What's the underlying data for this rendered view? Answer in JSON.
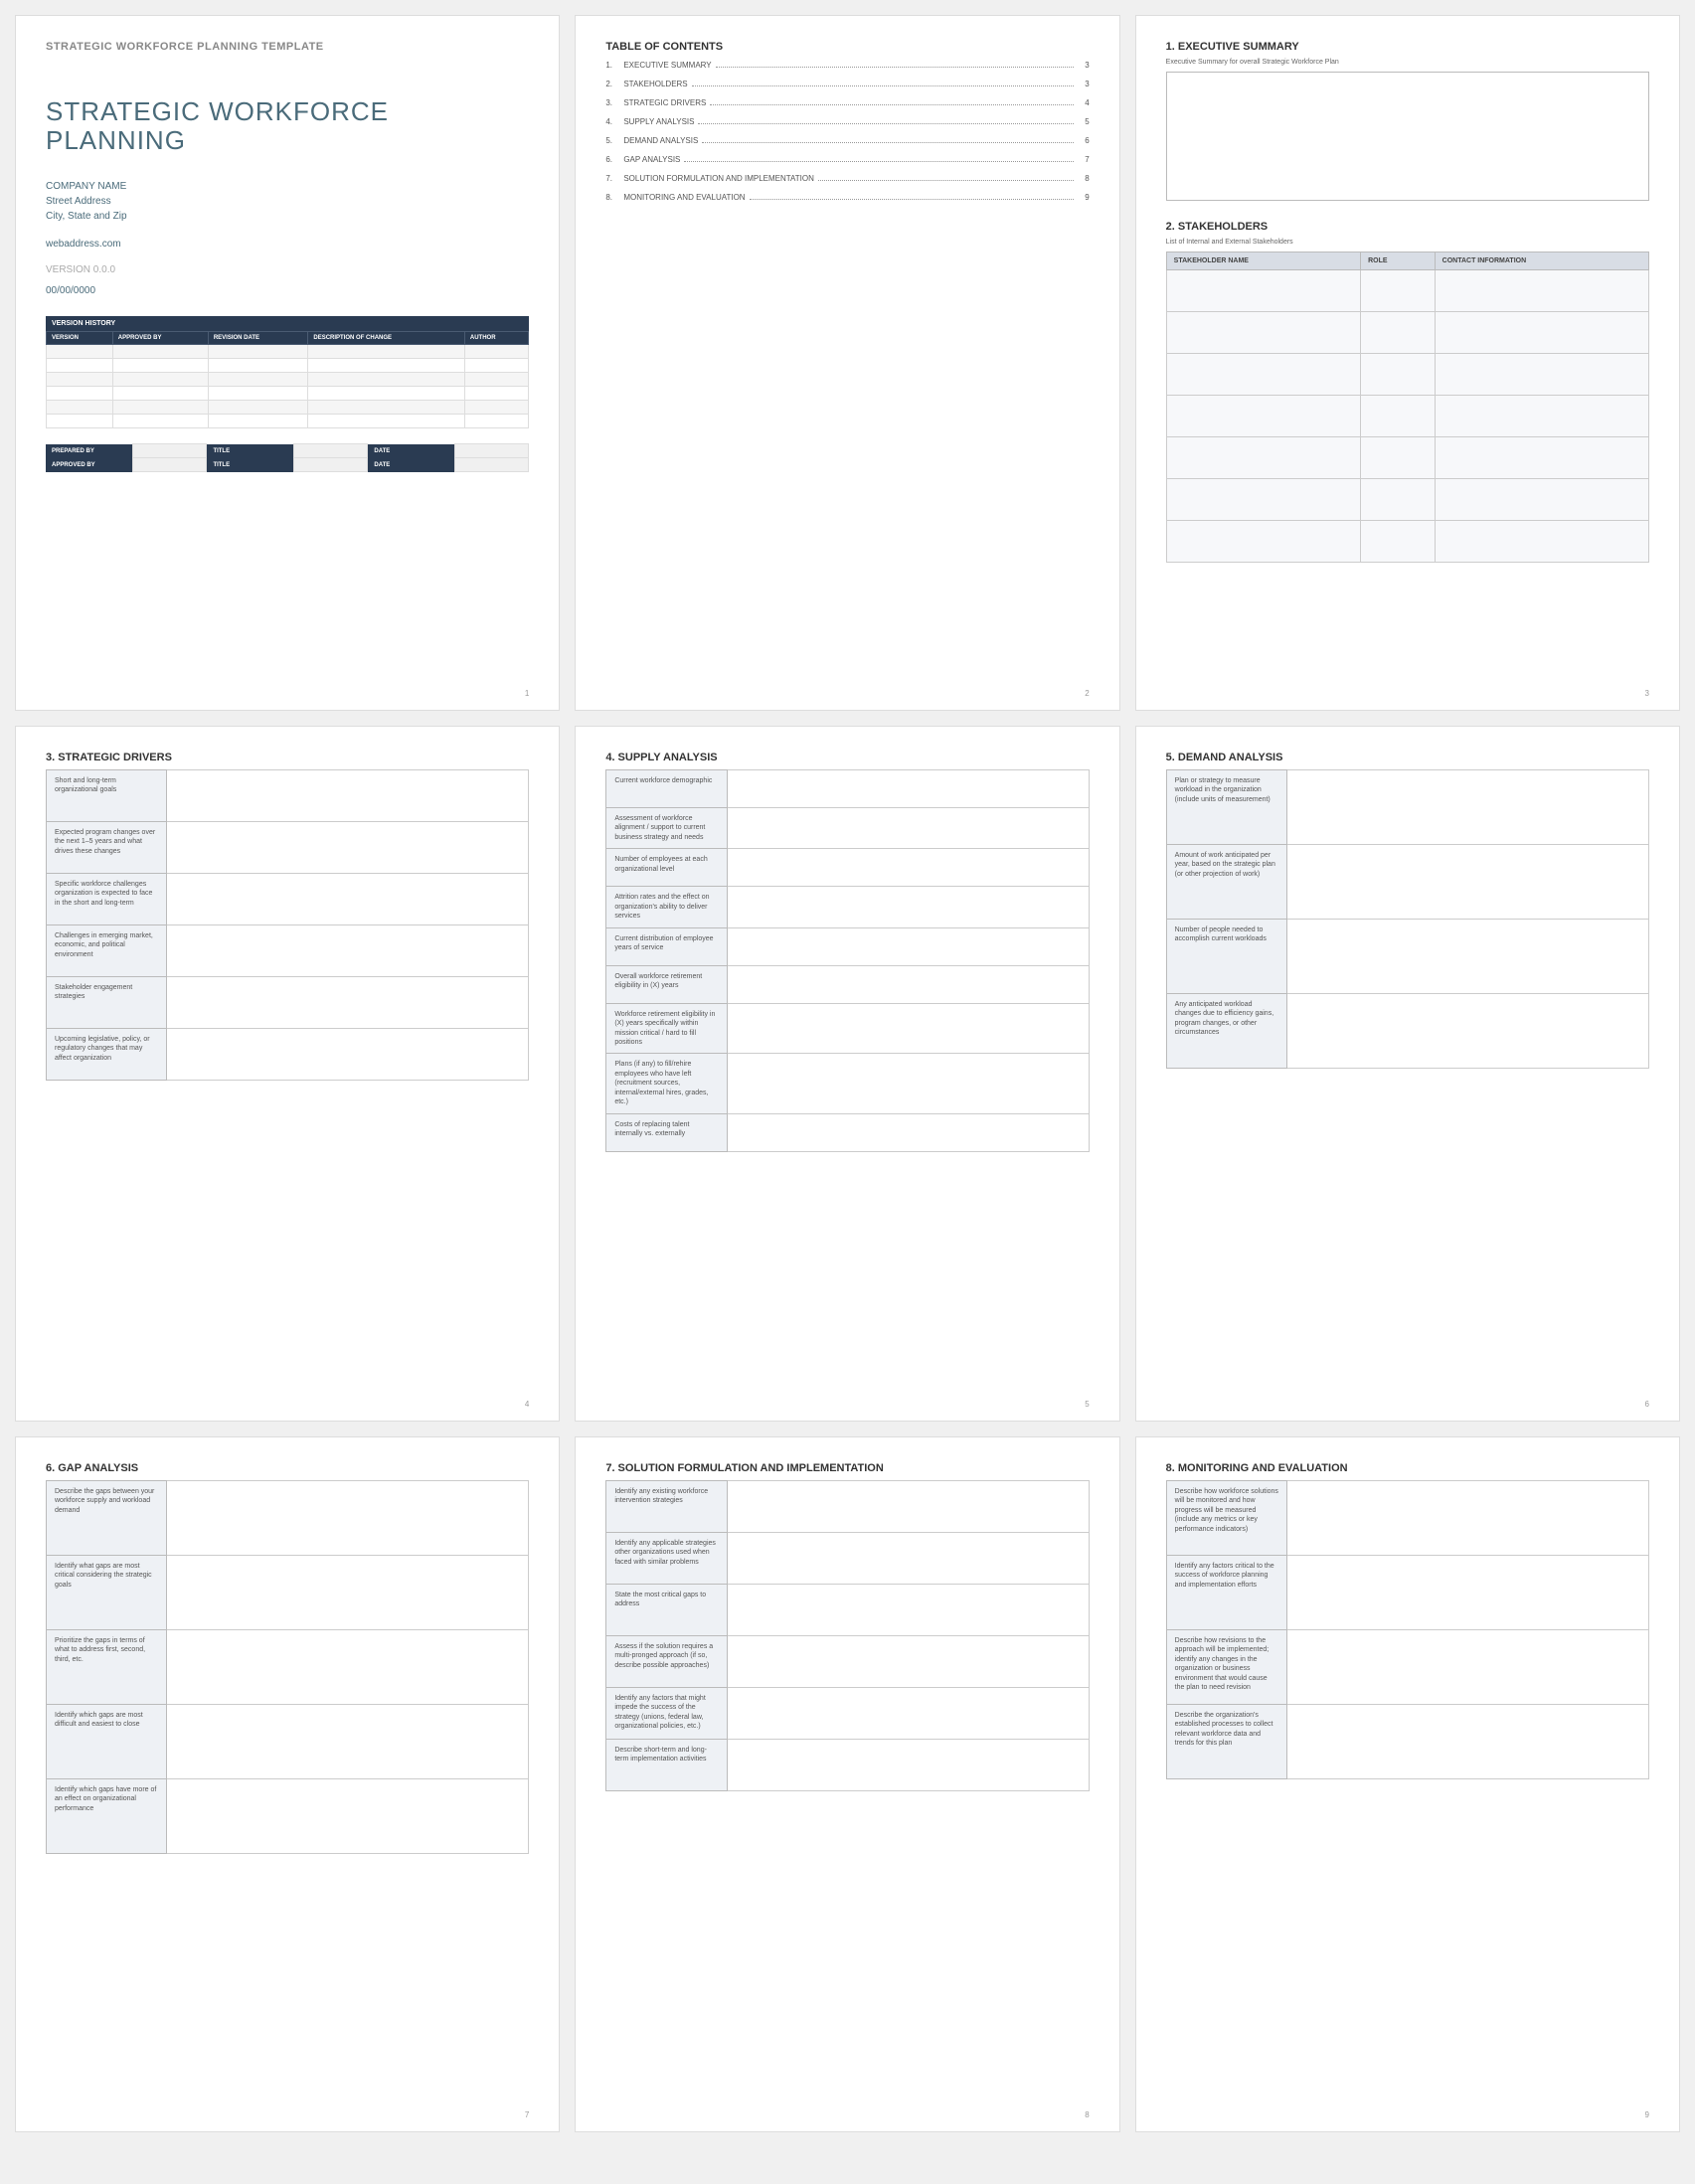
{
  "page1": {
    "template_header": "STRATEGIC WORKFORCE PLANNING TEMPLATE",
    "title": "STRATEGIC WORKFORCE PLANNING",
    "company": "COMPANY NAME",
    "street": "Street Address",
    "city": "City, State and Zip",
    "web": "webaddress.com",
    "version": "VERSION 0.0.0",
    "date": "00/00/0000",
    "vh_title": "VERSION HISTORY",
    "vh_headers": [
      "VERSION",
      "APPROVED BY",
      "REVISION DATE",
      "DESCRIPTION OF CHANGE",
      "AUTHOR"
    ],
    "sig": {
      "prepared": "PREPARED BY",
      "approved": "APPROVED BY",
      "title": "TITLE",
      "date": "DATE"
    }
  },
  "toc": {
    "heading": "TABLE OF CONTENTS",
    "items": [
      {
        "n": "1.",
        "label": "EXECUTIVE SUMMARY",
        "p": "3"
      },
      {
        "n": "2.",
        "label": "STAKEHOLDERS",
        "p": "3"
      },
      {
        "n": "3.",
        "label": "STRATEGIC DRIVERS",
        "p": "4"
      },
      {
        "n": "4.",
        "label": "SUPPLY ANALYSIS",
        "p": "5"
      },
      {
        "n": "5.",
        "label": "DEMAND ANALYSIS",
        "p": "6"
      },
      {
        "n": "6.",
        "label": "GAP ANALYSIS",
        "p": "7"
      },
      {
        "n": "7.",
        "label": "SOLUTION FORMULATION AND IMPLEMENTATION",
        "p": "8"
      },
      {
        "n": "8.",
        "label": "MONITORING AND EVALUATION",
        "p": "9"
      }
    ]
  },
  "p3": {
    "h1": "1. EXECUTIVE SUMMARY",
    "sub1": "Executive Summary for overall Strategic Workforce Plan",
    "h2": "2. STAKEHOLDERS",
    "sub2": "List of Internal and External Stakeholders",
    "cols": [
      "STAKEHOLDER NAME",
      "ROLE",
      "CONTACT INFORMATION"
    ]
  },
  "p4": {
    "h": "3. STRATEGIC DRIVERS",
    "rows": [
      "Short and long-term organizational goals",
      "Expected program changes over the next 1–5 years and what drives these changes",
      "Specific workforce challenges organization is expected to face in the short and long-term",
      "Challenges in emerging market, economic, and political environment",
      "Stakeholder engagement strategies",
      "Upcoming legislative, policy, or regulatory changes that may affect organization"
    ]
  },
  "p5": {
    "h": "4. SUPPLY ANALYSIS",
    "rows": [
      "Current workforce demographic",
      "Assessment of workforce alignment / support to current business strategy and needs",
      "Number of employees at each organizational level",
      "Attrition rates and the effect on organization's ability to deliver services",
      "Current distribution of employee years of service",
      "Overall workforce retirement eligibility in (X) years",
      "Workforce retirement eligibility in (X) years specifically within mission critical / hard to fill positions",
      "Plans (if any) to fill/rehire employees who have left (recruitment sources, internal/external hires, grades, etc.)",
      "Costs of replacing talent internally vs. externally"
    ]
  },
  "p6": {
    "h": "5. DEMAND ANALYSIS",
    "rows": [
      "Plan or strategy to measure workload in the organization (include units of measurement)",
      "Amount of work anticipated per year, based on the strategic plan (or other projection of work)",
      "Number of people needed to accomplish current workloads",
      "Any anticipated workload changes due to efficiency gains, program changes, or other circumstances"
    ]
  },
  "p7": {
    "h": "6. GAP ANALYSIS",
    "rows": [
      "Describe the gaps between your workforce supply and workload demand",
      "Identify what gaps are most critical considering the strategic goals",
      "Prioritize the gaps in terms of what to address first, second, third, etc.",
      "Identify which gaps are most difficult and easiest to close",
      "Identify which gaps have more of an effect on organizational performance"
    ]
  },
  "p8": {
    "h": "7. SOLUTION FORMULATION AND IMPLEMENTATION",
    "rows": [
      "Identify any existing workforce intervention strategies",
      "Identify any applicable strategies other organizations used when faced with similar problems",
      "State the most critical gaps to address",
      "Assess if the solution requires a multi-pronged approach (if so, describe possible approaches)",
      "Identify any factors that might impede the success of the strategy (unions, federal law, organizational policies, etc.)",
      "Describe short-term and long-term implementation activities"
    ]
  },
  "p9": {
    "h": "8. MONITORING AND EVALUATION",
    "rows": [
      "Describe how workforce solutions will be monitored and how progress will be measured (include any metrics or key performance indicators)",
      "Identify any factors critical to the success of workforce planning and implementation efforts",
      "Describe how revisions to the approach will be implemented; identify any changes in the organization or business environment that would cause the plan to need revision",
      "Describe the organization's established processes to collect relevant workforce data and trends for this plan"
    ]
  },
  "nums": {
    "p1": "1",
    "p2": "2",
    "p3": "3",
    "p4": "4",
    "p5": "5",
    "p6": "6",
    "p7": "7",
    "p8": "8",
    "p9": "9"
  }
}
